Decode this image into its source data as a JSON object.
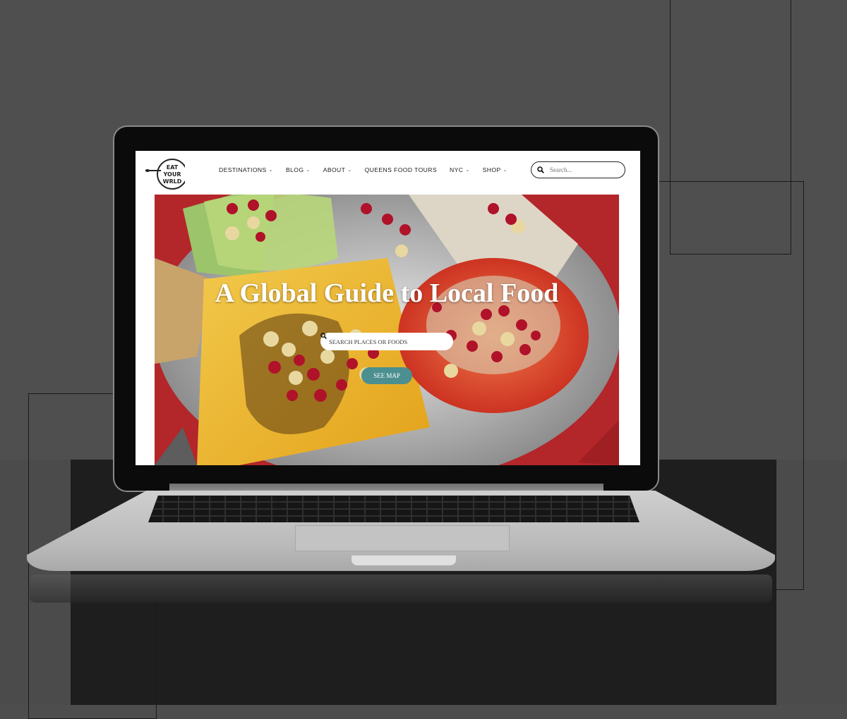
{
  "site": {
    "logo_text": "EAT YOUR WORLD",
    "nav": [
      {
        "label": "DESTINATIONS",
        "has_dropdown": true
      },
      {
        "label": "BLOG",
        "has_dropdown": true
      },
      {
        "label": "ABOUT",
        "has_dropdown": true
      },
      {
        "label": "QUEENS FOOD TOURS",
        "has_dropdown": false
      },
      {
        "label": "NYC",
        "has_dropdown": true
      },
      {
        "label": "SHOP",
        "has_dropdown": true
      }
    ],
    "search": {
      "placeholder": "Search...",
      "icon": "search-icon"
    }
  },
  "hero": {
    "title": "A Global Guide to Local Food",
    "search_placeholder": "SEARCH PLACES OR FOODS",
    "see_map_label": "SEE MAP"
  },
  "colors": {
    "background": "#4f4f4f",
    "accent_teal": "#4c8f90",
    "hero_red": "#b3262a"
  }
}
